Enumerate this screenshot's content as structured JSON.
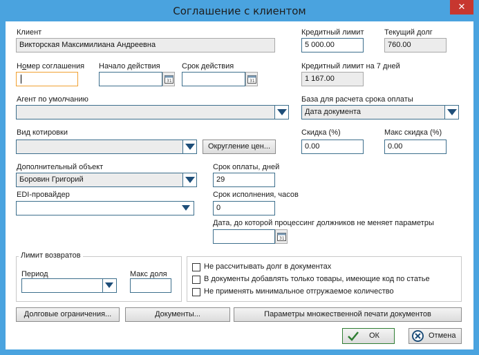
{
  "window": {
    "title": "Соглашение с клиентом",
    "close_glyph": "✕"
  },
  "client": {
    "label": "Клиент",
    "value": "Викторская Максимилиана Андреевна"
  },
  "credit_limit": {
    "label": "Кредитный лимит",
    "value": "5 000.00"
  },
  "current_debt": {
    "label": "Текущий долг",
    "value": "760.00"
  },
  "credit_limit_7d": {
    "label": "Кредитный лимит на 7 дней",
    "value": "1 167.00"
  },
  "agreement_number": {
    "label_pre": "Н",
    "label_ul": "о",
    "label_post": "мер соглашения",
    "value": ""
  },
  "start_date": {
    "label": "Начало действия",
    "value": ""
  },
  "end_date": {
    "label": "Срок действия",
    "value": ""
  },
  "default_agent": {
    "label": "Агент по умолчанию",
    "value": ""
  },
  "payment_basis": {
    "label": "База для расчета срока оплаты",
    "value": "Дата документа"
  },
  "quote_type": {
    "label": "Вид котировки",
    "value": ""
  },
  "rounding_button": {
    "label": "Округление цен..."
  },
  "discount": {
    "label": "Скидка (%)",
    "value": "0.00"
  },
  "max_discount": {
    "label": "Макс скидка (%)",
    "value": "0.00"
  },
  "extra_object": {
    "label": "Дополнительный объект",
    "value": "Боровин Григорий"
  },
  "payment_days": {
    "label": "Срок оплаты, дней",
    "value": "29"
  },
  "edi_provider": {
    "label": "EDI-провайдер",
    "value": ""
  },
  "execution_hours": {
    "label": "Срок исполнения, часов",
    "value": "0"
  },
  "processing_date": {
    "label": "Дата, до которой процессинг должников не меняет параметры",
    "value": ""
  },
  "returns_limit": {
    "title": "Лимит возвратов",
    "period_label": "Период",
    "period_value": "",
    "max_share_label": "Макс доля",
    "max_share_value": ""
  },
  "options": {
    "items": [
      {
        "label": "Не рассчитывать долг в документах",
        "checked": false
      },
      {
        "label": "В документы добавлять только товары, имеющие код по статье",
        "checked": false
      },
      {
        "label": "Не применять минимальное отгружаемое количество",
        "checked": false
      }
    ]
  },
  "bottom_buttons": {
    "debt_limits": "Долговые ограничения...",
    "documents": "Документы...",
    "print_params": "Параметры множественной печати документов"
  },
  "dialog_buttons": {
    "ok": "ОК",
    "cancel": "Отмена"
  },
  "colors": {
    "titlebar": "#4aa3df",
    "close": "#c7372f",
    "field_border": "#3c6e8c",
    "focus": "#f0a030",
    "ok_check": "#2e7d32",
    "cancel_icon": "#1e4e79"
  }
}
